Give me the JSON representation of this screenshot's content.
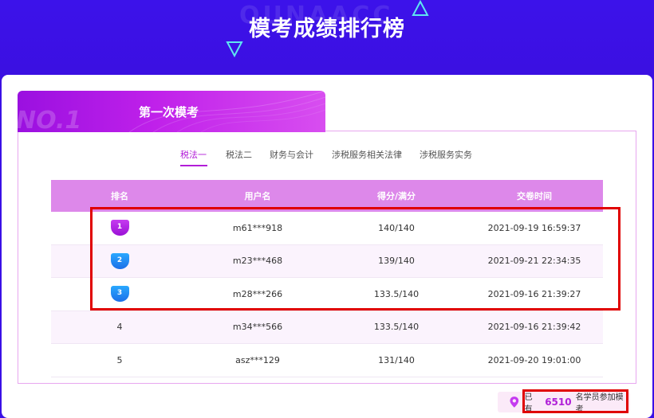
{
  "hero": {
    "ghost_text": "QUNAACC",
    "title": "模考成绩排行榜"
  },
  "exam": {
    "ghost_text": "NO.1",
    "title": "第一次模考"
  },
  "tabs": [
    {
      "label": "税法一",
      "active": true
    },
    {
      "label": "税法二",
      "active": false
    },
    {
      "label": "财务与会计",
      "active": false
    },
    {
      "label": "涉税服务相关法律",
      "active": false
    },
    {
      "label": "涉税服务实务",
      "active": false
    }
  ],
  "table": {
    "headers": [
      "排名",
      "用户名",
      "得分/满分",
      "交卷时间"
    ],
    "rows": [
      {
        "rank": "1",
        "user": "m61***918",
        "score": "140/140",
        "time": "2021-09-19 16:59:37"
      },
      {
        "rank": "2",
        "user": "m23***468",
        "score": "139/140",
        "time": "2021-09-21 22:34:35"
      },
      {
        "rank": "3",
        "user": "m28***266",
        "score": "133.5/140",
        "time": "2021-09-16 21:39:27"
      },
      {
        "rank": "4",
        "user": "m34***566",
        "score": "133.5/140",
        "time": "2021-09-16 21:39:42"
      },
      {
        "rank": "5",
        "user": "asz***129",
        "score": "131/140",
        "time": "2021-09-20 19:01:00"
      }
    ]
  },
  "footer": {
    "prefix": "已有",
    "count": "6510",
    "suffix": "名学员参加模考"
  },
  "colors": {
    "hero_bg": "#3a10e6",
    "accent": "#b21ed8",
    "table_header": "#dd88ea",
    "highlight_box": "#e00000"
  }
}
